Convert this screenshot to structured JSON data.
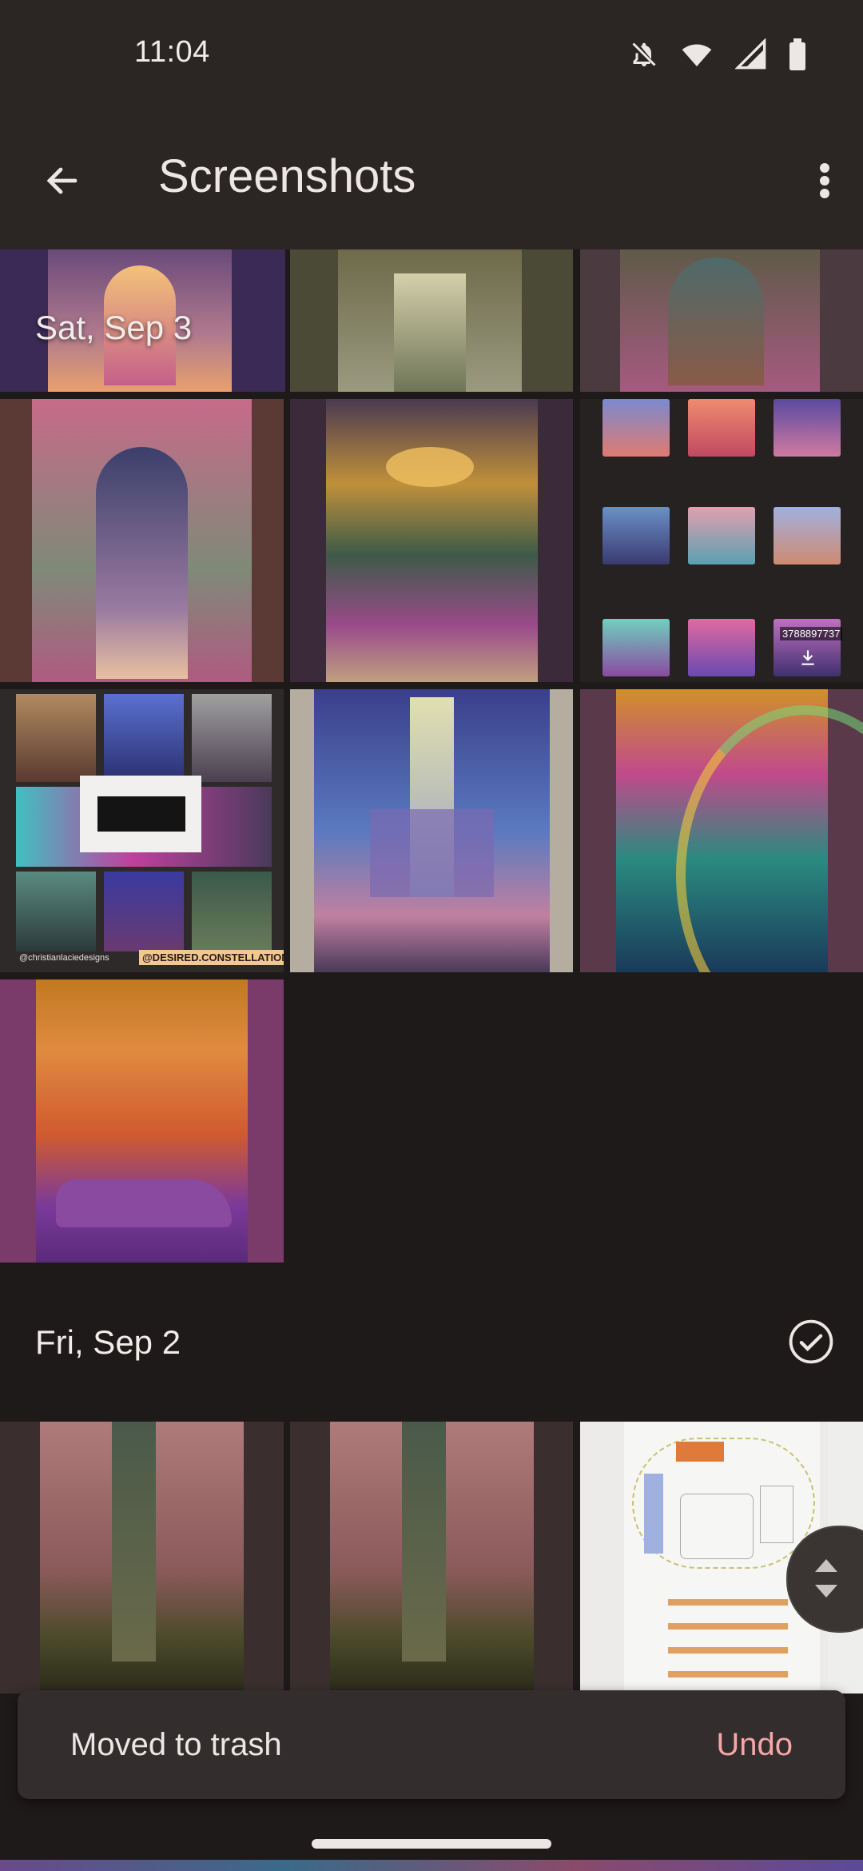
{
  "status": {
    "time": "11:04",
    "icons": [
      "bell-off-icon",
      "wifi-icon",
      "signal-icon",
      "battery-icon"
    ]
  },
  "appbar": {
    "title": "Screenshots",
    "back_icon": "arrow-left-icon",
    "menu_icon": "more-vert-icon"
  },
  "sections": [
    {
      "date": "Sat, Sep 3"
    },
    {
      "date": "Fri, Sep 2",
      "select_icon": "check-circle-icon"
    }
  ],
  "thumbs": {
    "collage_thumb_1_caption": "@christianlaciedesigns",
    "collage_thumb_1_tag": "@DESIRED.CONSTELLATION",
    "grid_thumb_count": "3788897737"
  },
  "snackbar": {
    "message": "Moved to trash",
    "action": "Undo"
  },
  "colors": {
    "background": "#1e1a1a",
    "appbar": "#2b2524",
    "accent": "#f5a6a6"
  }
}
